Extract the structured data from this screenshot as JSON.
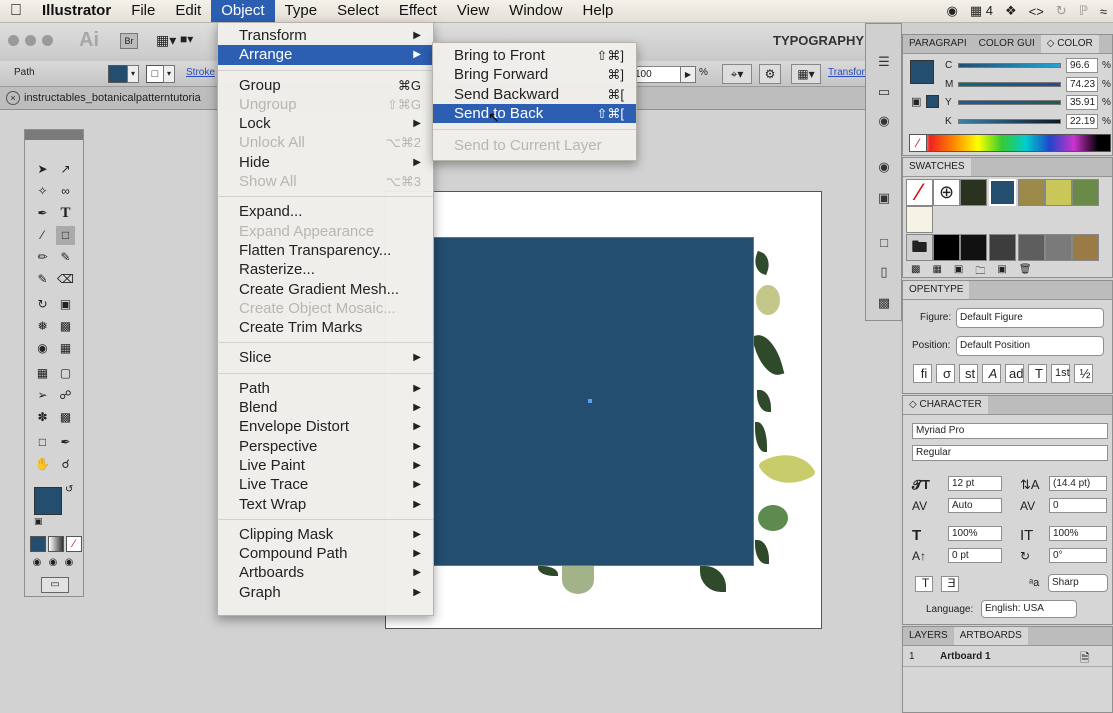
{
  "menubar": {
    "apple": "",
    "app": "Illustrator",
    "items": [
      "File",
      "Edit",
      "Object",
      "Type",
      "Select",
      "Effect",
      "View",
      "Window",
      "Help"
    ],
    "active": "Object",
    "status_number": "4"
  },
  "control_bar": {
    "ai_label": "Ai",
    "br_label": "Br",
    "workspace": "TYPOGRAPHY"
  },
  "prop_bar": {
    "object_type": "Path",
    "stroke_label": "Stroke",
    "opacity_value": "100",
    "percent": "%",
    "transform_label": "Transform"
  },
  "document_tab": {
    "title": "instructables_botanicalpatterntutoria"
  },
  "object_menu": {
    "items": [
      {
        "label": "Transform",
        "submenu": true
      },
      {
        "label": "Arrange",
        "submenu": true,
        "highlighted": true
      },
      {
        "sep": true
      },
      {
        "label": "Group",
        "shortcut": "⌘G"
      },
      {
        "label": "Ungroup",
        "shortcut": "⇧⌘G",
        "disabled": true
      },
      {
        "label": "Lock",
        "submenu": true
      },
      {
        "label": "Unlock All",
        "shortcut": "⌥⌘2",
        "disabled": true
      },
      {
        "label": "Hide",
        "submenu": true
      },
      {
        "label": "Show All",
        "shortcut": "⌥⌘3",
        "disabled": true
      },
      {
        "sep": true
      },
      {
        "label": "Expand..."
      },
      {
        "label": "Expand Appearance",
        "disabled": true
      },
      {
        "label": "Flatten Transparency..."
      },
      {
        "label": "Rasterize..."
      },
      {
        "label": "Create Gradient Mesh..."
      },
      {
        "label": "Create Object Mosaic...",
        "disabled": true
      },
      {
        "label": "Create Trim Marks"
      },
      {
        "sep": true
      },
      {
        "label": "Slice",
        "submenu": true
      },
      {
        "sep": true
      },
      {
        "label": "Path",
        "submenu": true
      },
      {
        "label": "Blend",
        "submenu": true
      },
      {
        "label": "Envelope Distort",
        "submenu": true
      },
      {
        "label": "Perspective",
        "submenu": true
      },
      {
        "label": "Live Paint",
        "submenu": true
      },
      {
        "label": "Live Trace",
        "submenu": true
      },
      {
        "label": "Text Wrap",
        "submenu": true
      },
      {
        "sep": true
      },
      {
        "label": "Clipping Mask",
        "submenu": true
      },
      {
        "label": "Compound Path",
        "submenu": true
      },
      {
        "label": "Artboards",
        "submenu": true
      },
      {
        "label": "Graph",
        "submenu": true
      }
    ]
  },
  "arrange_menu": {
    "items": [
      {
        "label": "Bring to Front",
        "shortcut": "⇧⌘]"
      },
      {
        "label": "Bring Forward",
        "shortcut": "⌘]"
      },
      {
        "label": "Send Backward",
        "shortcut": "⌘["
      },
      {
        "label": "Send to Back",
        "shortcut": "⇧⌘[",
        "highlighted": true
      },
      {
        "sep": true
      },
      {
        "label": "Send to Current Layer",
        "disabled": true
      }
    ]
  },
  "color_panel": {
    "tabs": [
      "PARAGRAPI",
      "COLOR GUI",
      "◇ COLOR"
    ],
    "channels": [
      {
        "name": "C",
        "value": "96.6"
      },
      {
        "name": "M",
        "value": "74.23"
      },
      {
        "name": "Y",
        "value": "35.91"
      },
      {
        "name": "K",
        "value": "22.19"
      }
    ],
    "unit": "%"
  },
  "swatches_panel": {
    "title": "SWATCHES"
  },
  "opentype_panel": {
    "title": "OPENTYPE",
    "figure_label": "Figure:",
    "figure_value": "Default Figure",
    "position_label": "Position:",
    "position_value": "Default Position"
  },
  "character_panel": {
    "title": "◇ CHARACTER",
    "font": "Myriad Pro",
    "style": "Regular",
    "size": "12 pt",
    "leading": "(14.4 pt)",
    "kerning": "Auto",
    "tracking": "0",
    "vscale": "100%",
    "hscale": "100%",
    "baseline": "0 pt",
    "rotation": "0°",
    "aa": "Sharp",
    "language_label": "Language:",
    "language": "English: USA"
  },
  "layers_panel": {
    "tabs": [
      "LAYERS",
      "ARTBOARDS"
    ],
    "row_number": "1",
    "row_label": "Artboard 1"
  },
  "colors": {
    "fill": "#234e70",
    "menu_highlight": "#2c5fb2"
  }
}
